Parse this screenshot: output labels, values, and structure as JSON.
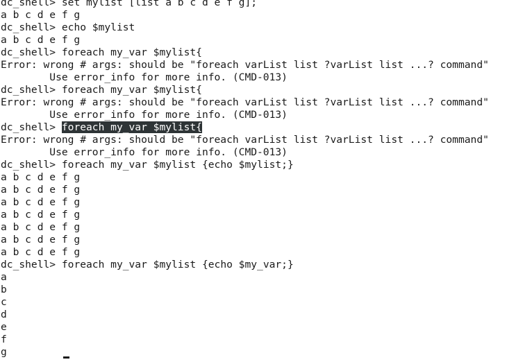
{
  "terminal": {
    "lines": [
      {
        "type": "prompt",
        "prompt": "dc_shell> ",
        "command": "set mylist [list a b c d e f g];"
      },
      {
        "type": "output",
        "text": "a b c d e f g"
      },
      {
        "type": "prompt",
        "prompt": "dc_shell> ",
        "command": "echo $mylist"
      },
      {
        "type": "output",
        "text": "a b c d e f g"
      },
      {
        "type": "prompt",
        "prompt": "dc_shell> ",
        "command": "foreach my_var $mylist{"
      },
      {
        "type": "output",
        "text": "Error: wrong # args: should be \"foreach varList list ?varList list ...? command\""
      },
      {
        "type": "output",
        "text": "        Use error_info for more info. (CMD-013)"
      },
      {
        "type": "prompt",
        "prompt": "dc_shell> ",
        "command": "foreach my_var $mylist{"
      },
      {
        "type": "output",
        "text": "Error: wrong # args: should be \"foreach varList list ?varList list ...? command\""
      },
      {
        "type": "output",
        "text": "        Use error_info for more info. (CMD-013)"
      },
      {
        "type": "prompt",
        "prompt": "dc_shell> ",
        "command": "foreach my_var $mylist{",
        "highlighted": true
      },
      {
        "type": "output",
        "text": "Error: wrong # args: should be \"foreach varList list ?varList list ...? command\""
      },
      {
        "type": "output",
        "text": "        Use error_info for more info. (CMD-013)"
      },
      {
        "type": "prompt",
        "prompt": "dc_shell> ",
        "command": "foreach my_var $mylist {echo $mylist;}"
      },
      {
        "type": "output",
        "text": "a b c d e f g"
      },
      {
        "type": "output",
        "text": "a b c d e f g"
      },
      {
        "type": "output",
        "text": "a b c d e f g"
      },
      {
        "type": "output",
        "text": "a b c d e f g"
      },
      {
        "type": "output",
        "text": "a b c d e f g"
      },
      {
        "type": "output",
        "text": "a b c d e f g"
      },
      {
        "type": "output",
        "text": "a b c d e f g"
      },
      {
        "type": "prompt",
        "prompt": "dc_shell> ",
        "command": "foreach my_var $mylist {echo $my_var;}"
      },
      {
        "type": "output",
        "text": "a"
      },
      {
        "type": "output",
        "text": "b"
      },
      {
        "type": "output",
        "text": "c"
      },
      {
        "type": "output",
        "text": "d"
      },
      {
        "type": "output",
        "text": "e"
      },
      {
        "type": "output",
        "text": "f"
      },
      {
        "type": "output",
        "text": "g"
      }
    ]
  },
  "colors": {
    "background": "#ffffff",
    "foreground": "#1a1a1a",
    "selection_bg": "#2e3436",
    "selection_fg": "#ffffff"
  }
}
